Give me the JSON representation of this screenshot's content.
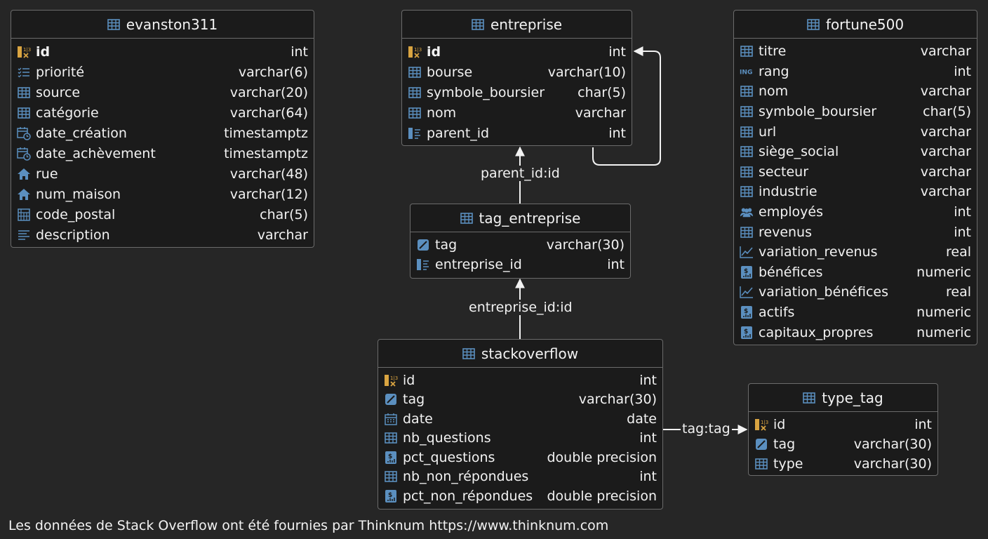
{
  "colors": {
    "background": "#262626",
    "table_bg": "#1b1b1b",
    "border": "#6b6b6b",
    "icon_blue": "#5b8fbf",
    "key_gold": "#d9a441"
  },
  "tables": {
    "evanston311": {
      "title": "evanston311",
      "columns": [
        {
          "name": "id",
          "type": "int",
          "icon": "key-icon"
        },
        {
          "name": "priorité",
          "type": "varchar(6)",
          "icon": "list-icon"
        },
        {
          "name": "source",
          "type": "varchar(20)",
          "icon": "table-icon"
        },
        {
          "name": "catégorie",
          "type": "varchar(64)",
          "icon": "table-icon"
        },
        {
          "name": "date_création",
          "type": "timestamptz",
          "icon": "calendar-clock-icon"
        },
        {
          "name": "date_achèvement",
          "type": "timestamptz",
          "icon": "calendar-clock-icon"
        },
        {
          "name": "rue",
          "type": "varchar(48)",
          "icon": "house-icon"
        },
        {
          "name": "num_maison",
          "type": "varchar(12)",
          "icon": "house-icon"
        },
        {
          "name": "code_postal",
          "type": "char(5)",
          "icon": "building-icon"
        },
        {
          "name": "description",
          "type": "varchar",
          "icon": "text-icon"
        }
      ]
    },
    "entreprise": {
      "title": "entreprise",
      "columns": [
        {
          "name": "id",
          "type": "int",
          "icon": "key-icon"
        },
        {
          "name": "bourse",
          "type": "varchar(10)",
          "icon": "table-icon"
        },
        {
          "name": "symbole_boursier",
          "type": "char(5)",
          "icon": "table-icon"
        },
        {
          "name": "nom",
          "type": "varchar",
          "icon": "table-icon"
        },
        {
          "name": "parent_id",
          "type": "int",
          "icon": "foreign-key-icon"
        }
      ]
    },
    "fortune500": {
      "title": "fortune500",
      "columns": [
        {
          "name": "titre",
          "type": "varchar",
          "icon": "table-icon"
        },
        {
          "name": "rang",
          "type": "int",
          "icon": "ing-icon"
        },
        {
          "name": "nom",
          "type": "varchar",
          "icon": "table-icon"
        },
        {
          "name": "symbole_boursier",
          "type": "char(5)",
          "icon": "table-icon"
        },
        {
          "name": "url",
          "type": "varchar",
          "icon": "table-icon"
        },
        {
          "name": "siège_social",
          "type": "varchar",
          "icon": "table-icon"
        },
        {
          "name": "secteur",
          "type": "varchar",
          "icon": "table-icon"
        },
        {
          "name": "industrie",
          "type": "varchar",
          "icon": "table-icon"
        },
        {
          "name": "employés",
          "type": "int",
          "icon": "people-icon"
        },
        {
          "name": "revenus",
          "type": "int",
          "icon": "table-icon"
        },
        {
          "name": "variation_revenus",
          "type": "real",
          "icon": "trend-icon"
        },
        {
          "name": "bénéfices",
          "type": "numeric",
          "icon": "dollar-icon"
        },
        {
          "name": "variation_bénéfices",
          "type": "real",
          "icon": "trend-icon"
        },
        {
          "name": "actifs",
          "type": "numeric",
          "icon": "dollar-icon"
        },
        {
          "name": "capitaux_propres",
          "type": "numeric",
          "icon": "dollar-icon"
        }
      ]
    },
    "tag_entreprise": {
      "title": "tag_entreprise",
      "columns": [
        {
          "name": "tag",
          "type": "varchar(30)",
          "icon": "tag-icon"
        },
        {
          "name": "entreprise_id",
          "type": "int",
          "icon": "foreign-key-icon"
        }
      ]
    },
    "stackoverflow": {
      "title": "stackoverflow",
      "columns": [
        {
          "name": "id",
          "type": "int",
          "icon": "key-icon"
        },
        {
          "name": "tag",
          "type": "varchar(30)",
          "icon": "tag-icon"
        },
        {
          "name": "date",
          "type": "date",
          "icon": "calendar-icon"
        },
        {
          "name": "nb_questions",
          "type": "int",
          "icon": "table-icon"
        },
        {
          "name": "pct_questions",
          "type": "double precision",
          "icon": "dollar-icon"
        },
        {
          "name": "nb_non_répondues",
          "type": "int",
          "icon": "table-icon"
        },
        {
          "name": "pct_non_répondues",
          "type": "double precision",
          "icon": "dollar-icon"
        }
      ]
    },
    "type_tag": {
      "title": "type_tag",
      "columns": [
        {
          "name": "id",
          "type": "int",
          "icon": "key-icon"
        },
        {
          "name": "tag",
          "type": "varchar(30)",
          "icon": "tag-icon"
        },
        {
          "name": "type",
          "type": "varchar(30)",
          "icon": "table-icon"
        }
      ]
    }
  },
  "relations": {
    "parent": "parent_id:id",
    "entreprise": "entreprise_id:id",
    "tag": "tag:tag"
  },
  "footnote": "Les données de Stack Overflow ont été fournies par Thinknum https://www.thinknum.com"
}
